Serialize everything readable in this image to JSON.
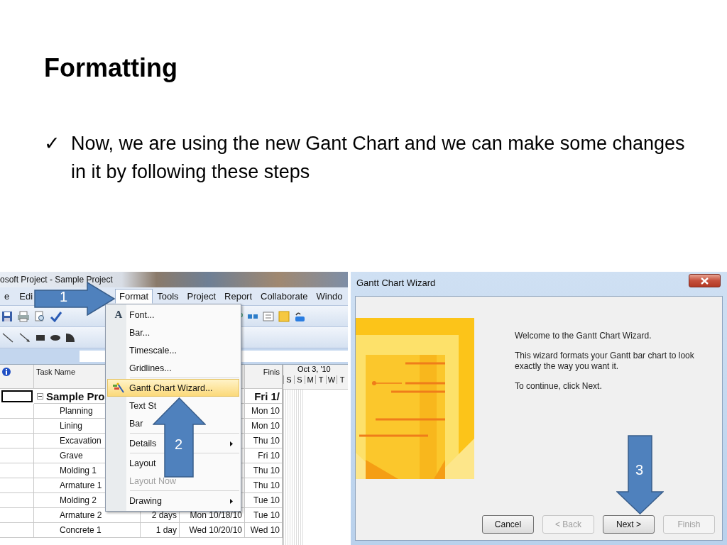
{
  "slide": {
    "title": "Formatting",
    "bullets": [
      {
        "marker": "✓",
        "text": "Now, we are using the new Gant Chart and we can make some changes in it by following these steps"
      }
    ]
  },
  "project_window": {
    "title": "osoft Project - Sample Project",
    "menu": [
      {
        "label": "e",
        "selected": false
      },
      {
        "label": "Edi",
        "selected": false
      },
      {
        "label": "Format",
        "selected": true
      },
      {
        "label": "Tools",
        "selected": false
      },
      {
        "label": "Project",
        "selected": false
      },
      {
        "label": "Report",
        "selected": false
      },
      {
        "label": "Collaborate",
        "selected": false
      },
      {
        "label": "Windo",
        "selected": false
      }
    ],
    "table": {
      "columns": [
        "Task Name",
        "Finis"
      ],
      "timescale": "Oct 3, '10",
      "days": [
        "S",
        "S",
        "M",
        "T",
        "W",
        "T"
      ],
      "rows": [
        {
          "kind": "summary",
          "selected": true,
          "task": "Sample Pro",
          "finish": "Fri 1/"
        },
        {
          "kind": "task",
          "selected": false,
          "task": "Planning",
          "finish": "Mon 10"
        },
        {
          "kind": "task",
          "selected": false,
          "task": "Lining",
          "finish": "Mon 10"
        },
        {
          "kind": "task",
          "selected": false,
          "task": "Excavation",
          "finish": "Thu 10"
        },
        {
          "kind": "task",
          "selected": false,
          "task": "Grave",
          "finish": "Fri 10"
        },
        {
          "kind": "task",
          "selected": false,
          "task": "Molding 1",
          "finish": "Thu 10"
        },
        {
          "kind": "task",
          "selected": false,
          "task": "Armature 1",
          "finish": "Thu 10"
        },
        {
          "kind": "task",
          "selected": false,
          "task": "Molding 2",
          "finish": "Tue 10"
        },
        {
          "kind": "task",
          "selected": false,
          "task": "Armature 2",
          "duration": "2 days",
          "start": "Mon 10/18/10",
          "finish": "Tue 10"
        },
        {
          "kind": "task",
          "selected": false,
          "task": "Concrete 1",
          "duration": "1 day",
          "start": "Wed 10/20/10",
          "finish": "Wed 10"
        }
      ]
    },
    "format_menu": {
      "items": [
        {
          "kind": "item",
          "glyph": "A",
          "label": "Font...",
          "highlighted": false,
          "disabled": false,
          "submenu": false
        },
        {
          "kind": "item",
          "label": "Bar...",
          "highlighted": false,
          "disabled": false,
          "submenu": false
        },
        {
          "kind": "item",
          "label": "Timescale...",
          "highlighted": false,
          "disabled": false,
          "submenu": false
        },
        {
          "kind": "item",
          "label": "Gridlines...",
          "highlighted": false,
          "disabled": false,
          "submenu": false
        },
        {
          "kind": "separator"
        },
        {
          "kind": "icon_item",
          "label": "Gantt Chart Wizard...",
          "highlighted": true,
          "disabled": false,
          "submenu": false
        },
        {
          "kind": "item",
          "label": "Text St",
          "highlighted": false,
          "disabled": false,
          "submenu": false
        },
        {
          "kind": "item",
          "label": "Bar",
          "highlighted": false,
          "disabled": false,
          "submenu": false
        },
        {
          "kind": "separator"
        },
        {
          "kind": "item",
          "label": "Details",
          "highlighted": false,
          "disabled": false,
          "submenu": true
        },
        {
          "kind": "separator"
        },
        {
          "kind": "item",
          "label": "Layout",
          "highlighted": false,
          "disabled": false,
          "submenu": false
        },
        {
          "kind": "item",
          "label": "Layout Now",
          "highlighted": false,
          "disabled": true,
          "submenu": false
        },
        {
          "kind": "separator"
        },
        {
          "kind": "item",
          "label": "Drawing",
          "highlighted": false,
          "disabled": false,
          "submenu": true
        }
      ]
    },
    "callouts": [
      {
        "kind": "right",
        "number": "1"
      },
      {
        "kind": "up",
        "number": "2"
      }
    ]
  },
  "wizard_dialog": {
    "title": "Gantt Chart Wizard",
    "paragraphs": [
      "Welcome to the Gantt Chart Wizard.",
      "This wizard formats your Gantt bar chart to look exactly the way you want it.",
      "To continue, click Next."
    ],
    "buttons": [
      {
        "label": "Cancel",
        "disabled": false
      },
      {
        "label": "< Back",
        "disabled": true
      },
      {
        "label": "Next >",
        "disabled": false
      },
      {
        "label": "Finish",
        "disabled": true
      }
    ],
    "callouts": [
      {
        "kind": "down",
        "number": "3"
      }
    ]
  }
}
